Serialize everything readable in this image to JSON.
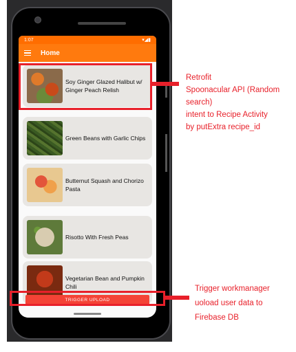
{
  "status_bar": {
    "time": "1:07",
    "icons": "▾◢▮"
  },
  "app_bar": {
    "title": "Home",
    "menu_icon": "hamburger-menu-icon"
  },
  "recipes": [
    {
      "title": "Soy Ginger Glazed Halibut w/ Ginger Peach Relish"
    },
    {
      "title": "Green Beans with Garlic Chips"
    },
    {
      "title": "Butternut Squash and Chorizo Pasta"
    },
    {
      "title": "Risotto With Fresh Peas"
    },
    {
      "title": "Vegetarian Bean and Pumpkin Chili"
    }
  ],
  "upload_button": {
    "label": "TRIGGER UPLOAD"
  },
  "annotations": {
    "top": [
      "Retrofit",
      "Spoonacular API (Random",
      "search)",
      "intent to Recipe Activity",
      "by putExtra recipe_id"
    ],
    "bottom": [
      "Trigger workmanager",
      "uoload user data to",
      "Firebase DB"
    ]
  },
  "colors": {
    "appbar": "#ff7a0e",
    "accent": "#e8202a",
    "button": "#f44336"
  }
}
